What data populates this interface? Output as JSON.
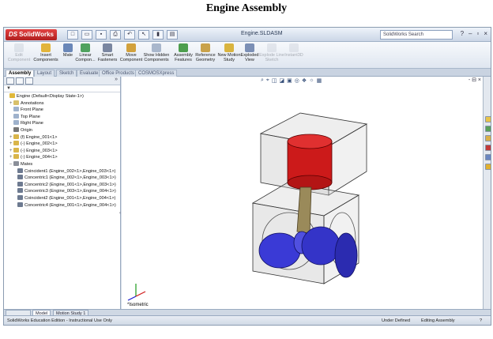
{
  "caption": "Engine Assembly",
  "app": {
    "logo_prefix": "DS",
    "logo_text": "SolidWorks",
    "document_title": "Engine.SLDASM",
    "search_placeholder": "SolidWorks Search",
    "help_symbol": "?",
    "window_buttons": [
      "–",
      "▫",
      "×"
    ]
  },
  "ribbon": [
    {
      "label": "Edit Component",
      "enabled": false,
      "color": "#b9c2cf"
    },
    {
      "label": "Insert Components",
      "enabled": true,
      "color": "#e2b43a"
    },
    {
      "label": "Mate",
      "enabled": true,
      "color": "#6a87b8"
    },
    {
      "label": "Linear Compon...",
      "enabled": true,
      "color": "#4fa25e"
    },
    {
      "label": "Smart Fasteners",
      "enabled": true,
      "color": "#7a86a0"
    },
    {
      "label": "Move Component",
      "enabled": true,
      "color": "#d2a13c"
    },
    {
      "label": "Show Hidden Components",
      "enabled": true,
      "color": "#a9b7cc"
    },
    {
      "label": "Assembly Features",
      "enabled": true,
      "color": "#4d9e4d"
    },
    {
      "label": "Reference Geometry",
      "enabled": true,
      "color": "#c9a24b"
    },
    {
      "label": "New Motion Study",
      "enabled": true,
      "color": "#d9b43f"
    },
    {
      "label": "Exploded View",
      "enabled": true,
      "color": "#7b8fb5"
    },
    {
      "label": "Explode Line Sketch",
      "enabled": false,
      "color": "#c0c7d2"
    },
    {
      "label": "Instant3D",
      "enabled": false,
      "color": "#c0c7d2"
    }
  ],
  "tabs": [
    "Assembly",
    "Layout",
    "Sketch",
    "Evaluate",
    "Office Products",
    "COSMOSXpress"
  ],
  "active_tab": "Assembly",
  "feature_manager": {
    "filter": "▼",
    "tree": [
      {
        "label": "Engine  (Default<Display State-1>)",
        "level": 0,
        "expand": "",
        "icon": "#e0b83a"
      },
      {
        "label": "Annotations",
        "level": 1,
        "expand": "+",
        "icon": "#d8c06a"
      },
      {
        "label": "Front Plane",
        "level": 1,
        "expand": "",
        "icon": "#9fb2cc"
      },
      {
        "label": "Top Plane",
        "level": 1,
        "expand": "",
        "icon": "#9fb2cc"
      },
      {
        "label": "Right Plane",
        "level": 1,
        "expand": "",
        "icon": "#9fb2cc"
      },
      {
        "label": "Origin",
        "level": 1,
        "expand": "",
        "icon": "#777777"
      },
      {
        "label": "(f) Engine_001<1>",
        "level": 1,
        "expand": "+",
        "icon": "#d9b54a"
      },
      {
        "label": "(-) Engine_002<1>",
        "level": 1,
        "expand": "+",
        "icon": "#d9b54a"
      },
      {
        "label": "(-) Engine_003<1>",
        "level": 1,
        "expand": "+",
        "icon": "#d9b54a"
      },
      {
        "label": "(-) Engine_004<1>",
        "level": 1,
        "expand": "+",
        "icon": "#d9b54a"
      },
      {
        "label": "Mates",
        "level": 1,
        "expand": "–",
        "icon": "#8a8f99"
      },
      {
        "label": "Coincident1 (Engine_002<1>,Engine_003<1>)",
        "level": 2,
        "expand": "",
        "icon": "#6d7a90"
      },
      {
        "label": "Concentric1 (Engine_002<1>,Engine_003<1>)",
        "level": 2,
        "expand": "",
        "icon": "#6d7a90"
      },
      {
        "label": "Concentric2 (Engine_001<1>,Engine_003<1>)",
        "level": 2,
        "expand": "",
        "icon": "#6d7a90"
      },
      {
        "label": "Concentric3 (Engine_003<1>,Engine_004<1>)",
        "level": 2,
        "expand": "",
        "icon": "#6d7a90"
      },
      {
        "label": "Coincident2 (Engine_001<1>,Engine_004<1>)",
        "level": 2,
        "expand": "",
        "icon": "#6d7a90"
      },
      {
        "label": "Concentric4 (Engine_001<1>,Engine_004<1>)",
        "level": 2,
        "expand": "",
        "icon": "#6d7a90"
      }
    ]
  },
  "viewport": {
    "view_label": "*Isometric",
    "hud_icons": [
      "⌕",
      "⌖",
      "◫",
      "◪",
      "▣",
      "◎",
      "❖",
      "☼",
      "▦"
    ],
    "window_controls": "- ⊟ ×",
    "colors": {
      "housing": "#c9c9c9",
      "piston": "#cc1a1a",
      "crank": "#3a3ad6",
      "rod": "#9a8a5a"
    }
  },
  "bottom_tabs": [
    "Model",
    "Motion Study 1"
  ],
  "status": {
    "left": "SolidWorks Education Edition - Instructional Use Only",
    "defined": "Under Defined",
    "mode": "Editing Assembly"
  }
}
